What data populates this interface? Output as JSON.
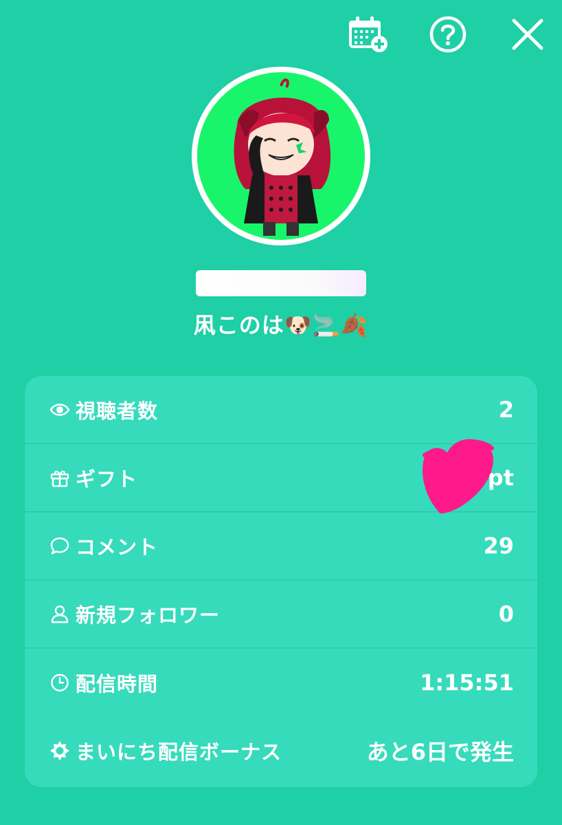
{
  "header": {
    "icons": [
      "calendar-add-icon",
      "help-icon",
      "close-icon"
    ]
  },
  "profile": {
    "display_name": "凩このは🐶🚬🍂"
  },
  "stats": [
    {
      "icon": "eye-icon",
      "label": "視聴者数",
      "value": "2"
    },
    {
      "icon": "gift-icon",
      "label": "ギフト",
      "value": "pt"
    },
    {
      "icon": "comment-icon",
      "label": "コメント",
      "value": "29"
    },
    {
      "icon": "person-icon",
      "label": "新規フォロワー",
      "value": "0"
    },
    {
      "icon": "clock-icon",
      "label": "配信時間",
      "value": "1:15:51"
    },
    {
      "icon": "sun-icon",
      "label": "まいにち配信ボーナス",
      "value": "あと6日で発生"
    }
  ],
  "colors": {
    "background": "#1fcfa5",
    "card": "#36dbbc",
    "avatar_bg": "#19f56b",
    "scribble": "#ff1a8c"
  }
}
